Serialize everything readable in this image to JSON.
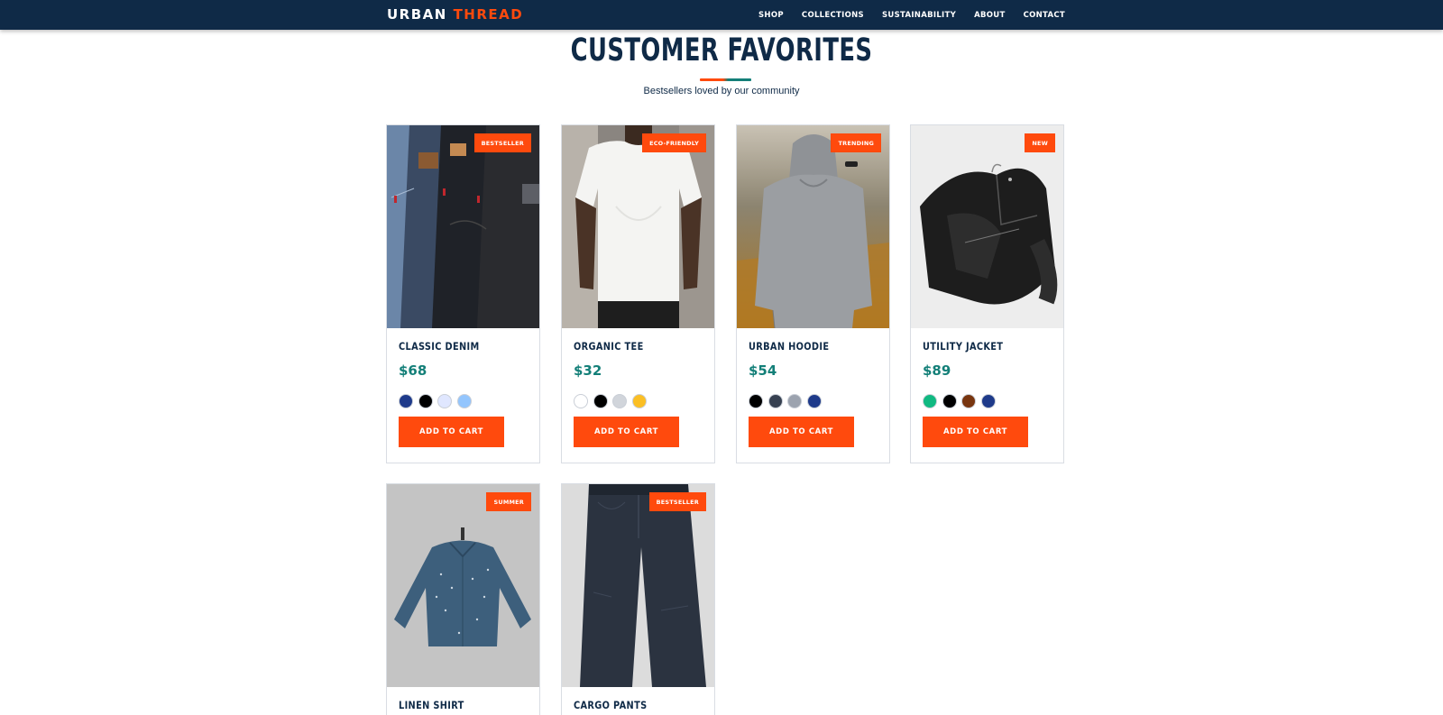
{
  "brand": {
    "name_part1": "URBAN",
    "name_part2": "THREAD",
    "accent_color": "#ff4a0d",
    "navy_color": "#0f2a47"
  },
  "nav": {
    "items": [
      "SHOP",
      "COLLECTIONS",
      "SUSTAINABILITY",
      "ABOUT",
      "CONTACT"
    ]
  },
  "section": {
    "title": "CUSTOMER FAVORITES",
    "subtitle": "Bestsellers loved by our community"
  },
  "products": [
    {
      "name": "CLASSIC DENIM",
      "price": "$68",
      "badge": "BESTSELLER",
      "image_icon": "denim-jeans-photo",
      "swatches": [
        "#1e3a8a",
        "#000000",
        "#e0e7ff",
        "#93c5fd"
      ],
      "button": "ADD TO CART"
    },
    {
      "name": "ORGANIC TEE",
      "price": "$32",
      "badge": "ECO-FRIENDLY",
      "image_icon": "white-tshirt-photo",
      "swatches": [
        "#ffffff",
        "#000000",
        "#d1d5db",
        "#fbbf24"
      ],
      "button": "ADD TO CART"
    },
    {
      "name": "URBAN HOODIE",
      "price": "$54",
      "badge": "TRENDING",
      "image_icon": "grey-hoodie-photo",
      "swatches": [
        "#000000",
        "#374151",
        "#9ca3af",
        "#1e3a8a"
      ],
      "button": "ADD TO CART"
    },
    {
      "name": "UTILITY JACKET",
      "price": "$89",
      "badge": "NEW",
      "image_icon": "leather-jacket-photo",
      "swatches": [
        "#10b981",
        "#000000",
        "#78350f",
        "#1e3a8a"
      ],
      "button": "ADD TO CART"
    },
    {
      "name": "LINEN SHIRT",
      "price": "",
      "badge": "SUMMER",
      "image_icon": "denim-shirt-photo",
      "swatches": [],
      "button": ""
    },
    {
      "name": "CARGO PANTS",
      "price": "",
      "badge": "BESTSELLER",
      "image_icon": "dark-jeans-photo",
      "swatches": [],
      "button": ""
    }
  ]
}
